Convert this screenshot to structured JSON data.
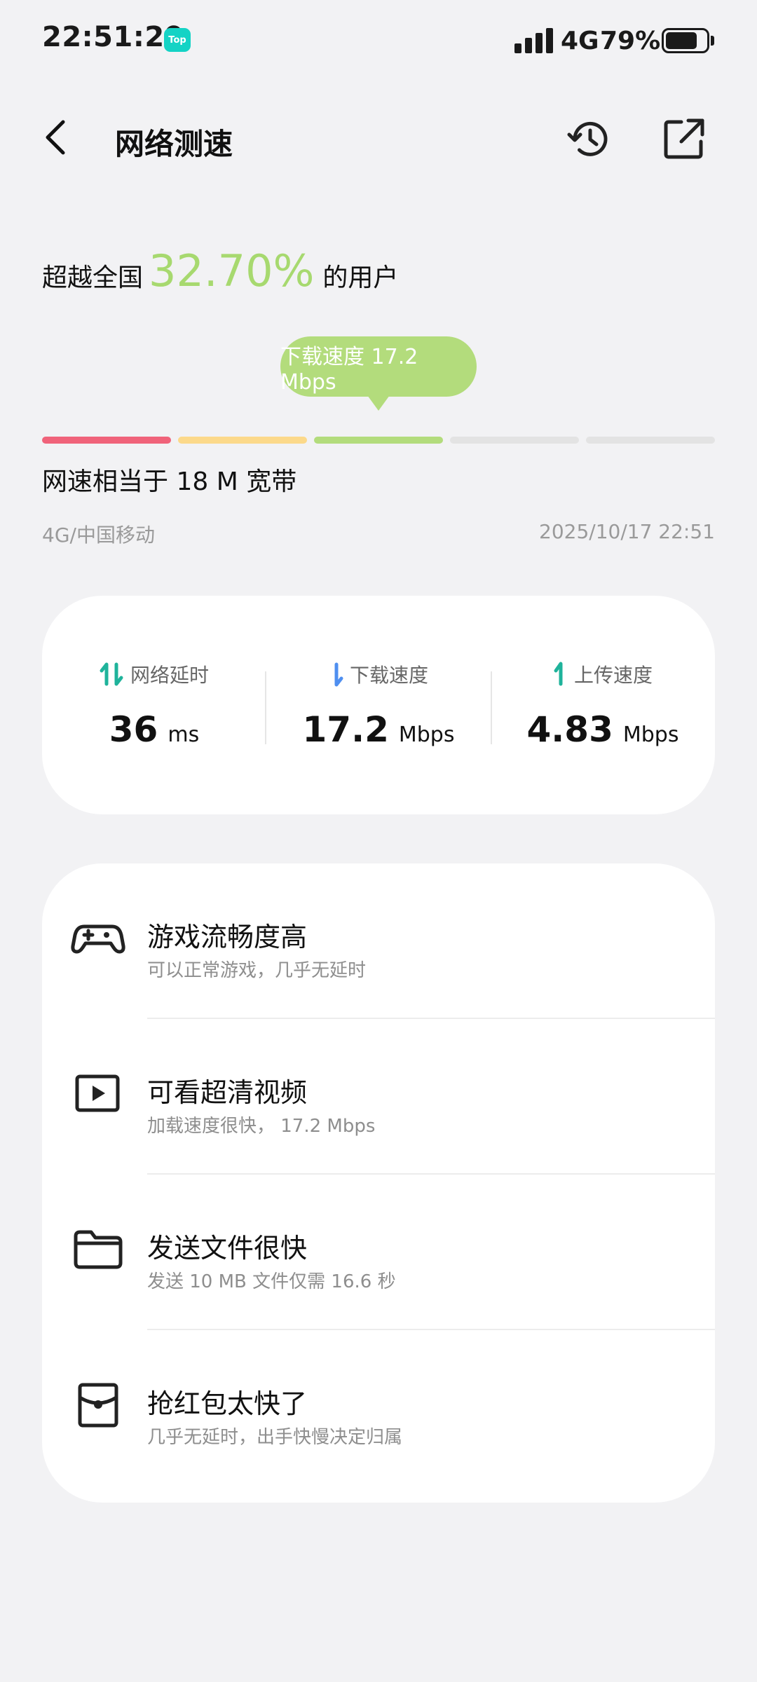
{
  "status_bar": {
    "time": "22:51:29",
    "app_badge": "Top",
    "network": "4G",
    "battery": "79%",
    "battery_level": 0.79
  },
  "header": {
    "title": "网络测速",
    "back_icon": "chevron-left-icon",
    "history_icon": "history-icon",
    "share_icon": "share-icon"
  },
  "rank": {
    "prefix": "超越全国",
    "value": "32.70%",
    "suffix": "的用户",
    "color": "#a7d96f"
  },
  "tooltip": {
    "text": "下载速度 17.2 Mbps",
    "color": "#b3dc7c"
  },
  "level_bar": {
    "colors": [
      "#f0637a",
      "#fcd98a",
      "#b3dc7c",
      "#e3e3e3",
      "#e3e3e3"
    ],
    "active_level": 3
  },
  "equivalent": "网速相当于 18 M 宽带",
  "carrier": "4G/中国移动",
  "test_time": "2025/10/17 22:51",
  "metrics": [
    {
      "label": "网络延时",
      "value": "36",
      "unit": "ms",
      "icon": "latency-arrows-icon",
      "color": "#1fb39b"
    },
    {
      "label": "下载速度",
      "value": "17.2",
      "unit": "Mbps",
      "icon": "download-arrow-icon",
      "color": "#4f8ff0"
    },
    {
      "label": "上传速度",
      "value": "4.83",
      "unit": "Mbps",
      "icon": "upload-arrow-icon",
      "color": "#1fb39b"
    }
  ],
  "features": [
    {
      "title": "游戏流畅度高",
      "desc": "可以正常游戏，几乎无延时",
      "icon": "gamepad-icon"
    },
    {
      "title": "可看超清视频",
      "desc": "加载速度很快， 17.2 Mbps",
      "icon": "video-play-icon"
    },
    {
      "title": "发送文件很快",
      "desc": "发送 10 MB 文件仅需 16.6 秒",
      "icon": "folder-icon"
    },
    {
      "title": "抢红包太快了",
      "desc": "几乎无延时，出手快慢决定归属",
      "icon": "red-packet-icon"
    }
  ]
}
